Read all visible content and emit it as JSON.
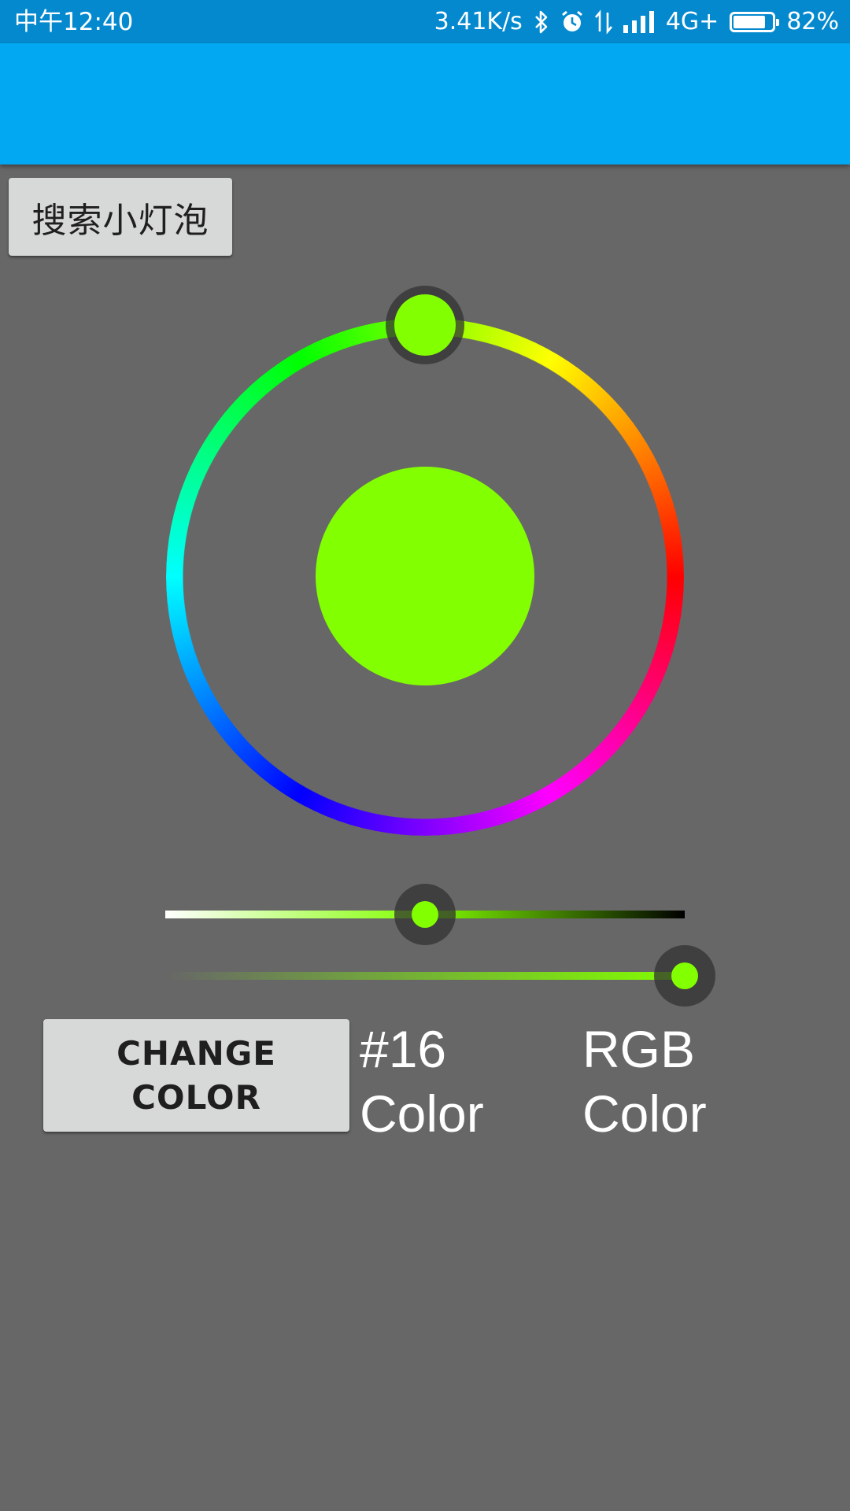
{
  "status_bar": {
    "time": "中午12:40",
    "network_speed": "3.41K/s",
    "network_type": "4G+",
    "battery_text": "82%",
    "battery_level": 0.82,
    "icons": [
      "bluetooth-icon",
      "alarm-icon",
      "data-transfer-icon",
      "signal-icon",
      "battery-icon"
    ]
  },
  "app_bar": {
    "color": "#03a8f3"
  },
  "search_button": {
    "label": "搜索小灯泡"
  },
  "color_picker": {
    "selected_color": "#82ff00",
    "hue_thumb_color": "#82ff00"
  },
  "sliders": {
    "brightness": {
      "value": 0.5,
      "end_colors": [
        "#ffffff",
        "#000000"
      ]
    },
    "saturation": {
      "value": 1.0
    }
  },
  "change_color_button": {
    "label": "CHANGE COLOR"
  },
  "hex_color_label": "#16\nColor",
  "rgb_color_label": "RGB\nColor"
}
